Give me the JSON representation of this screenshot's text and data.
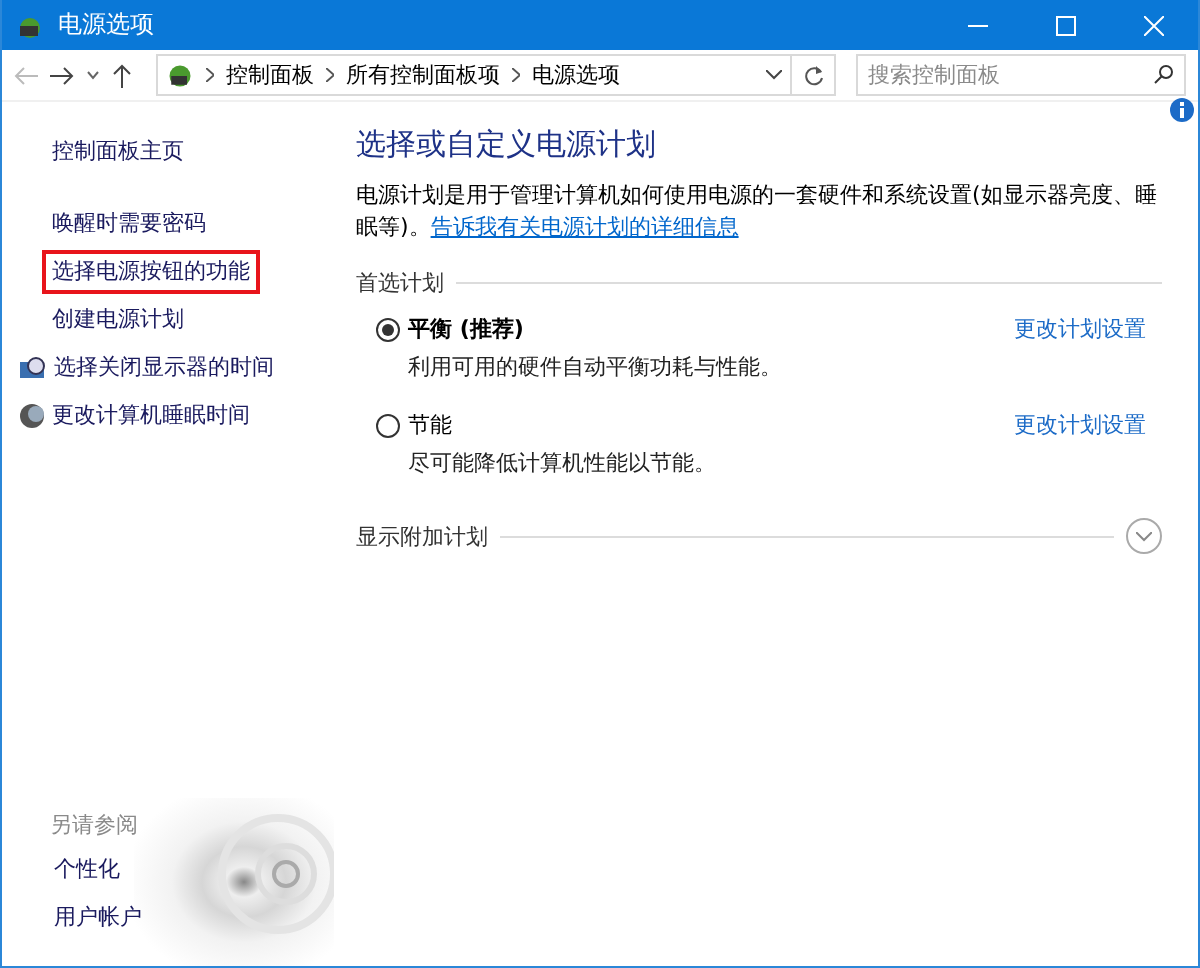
{
  "window": {
    "title": "电源选项"
  },
  "address_bar": {
    "path": [
      "控制面板",
      "所有控制面板项",
      "电源选项"
    ]
  },
  "search": {
    "placeholder": "搜索控制面板"
  },
  "sidebar": {
    "home": "控制面板主页",
    "items": [
      {
        "label": "唤醒时需要密码",
        "kind": "plain",
        "highlighted": false
      },
      {
        "label": "选择电源按钮的功能",
        "kind": "plain",
        "highlighted": true
      },
      {
        "label": "创建电源计划",
        "kind": "plain",
        "highlighted": false
      },
      {
        "label": "选择关闭显示器的时间",
        "kind": "display",
        "highlighted": false
      },
      {
        "label": "更改计算机睡眠时间",
        "kind": "sleep",
        "highlighted": false
      }
    ],
    "see_also": {
      "title": "另请参阅",
      "links": [
        "个性化",
        "用户帐户"
      ]
    }
  },
  "main": {
    "heading": "选择或自定义电源计划",
    "description": "电源计划是用于管理计算机如何使用电源的一套硬件和系统设置(如显示器亮度、睡眠等)。",
    "description_link": "告诉我有关电源计划的详细信息",
    "section_title": "首选计划",
    "plans": [
      {
        "name": "平衡 (推荐)",
        "description": "利用可用的硬件自动平衡功耗与性能。",
        "link": "更改计划设置",
        "selected": true
      },
      {
        "name": "节能",
        "description": "尽可能降低计算机性能以节能。",
        "link": "更改计划设置",
        "selected": false
      }
    ],
    "additional_plans": {
      "title": "显示附加计划",
      "expanded": false
    }
  }
}
